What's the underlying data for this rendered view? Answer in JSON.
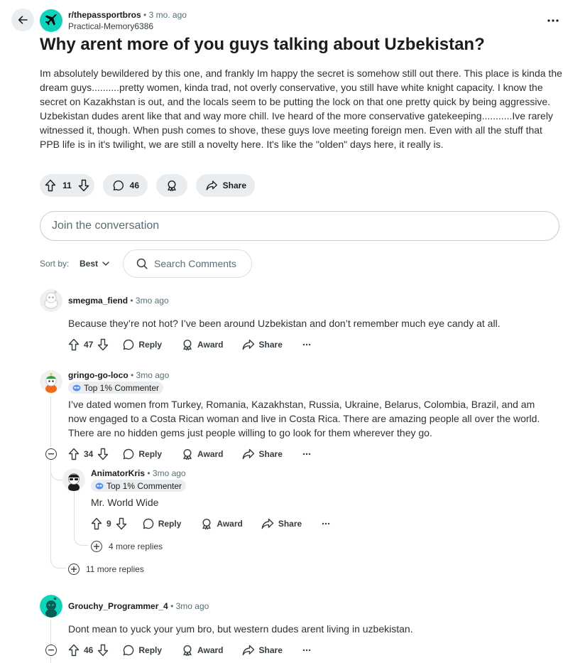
{
  "post": {
    "subreddit": "r/thepassportbros",
    "time_ago": "3 mo. ago",
    "author": "Practical-Memory6386",
    "title": "Why arent more of you guys talking about Uzbekistan?",
    "body": "Im absolutely bewildered by this one, and frankly Im happy the secret is somehow still out there. This place is kinda the dream guys..........pretty women, kinda trad, not overly conservative, you still have white knight capacity. I know the secret on Kazakhstan is out, and the locals seem to be putting the lock on that one pretty quick by being aggressive. Uzbekistan dudes arent like that and way more chill. Ive heard of the more conservative gatekeeping...........Ive rarely witnessed it, though. When push comes to shove, these guys love meeting foreign men. Even with all the stuff that PPB life is in it's twilight, we are still a novelty here. It's like the \"olden\" days here, it really is.",
    "upvotes": "11",
    "comments_count": "46",
    "share_label": "Share"
  },
  "join": {
    "placeholder": "Join the conversation"
  },
  "sort": {
    "label": "Sort by:",
    "value": "Best"
  },
  "search": {
    "placeholder": "Search Comments"
  },
  "labels": {
    "reply": "Reply",
    "award": "Award",
    "share": "Share"
  },
  "comments": [
    {
      "user": "smegma_fiend",
      "time_ago": "3mo ago",
      "body": "Because they’re not hot? I’ve been around Uzbekistan and don’t remember much eye candy at all.",
      "votes": "47"
    },
    {
      "user": "gringo-go-loco",
      "time_ago": "3mo ago",
      "flair": "Top 1% Commenter",
      "body": "I’ve dated women from Turkey, Romania, Kazakhstan, Russia, Ukraine, Belarus, Colombia, Brazil, and am now engaged to a Costa Rican woman and live in Costa Rica. There are amazing people all over the world. There are no hidden gems just people willing to go look for them wherever they go.",
      "votes": "34",
      "more_replies": "11 more replies"
    },
    {
      "user": "AnimatorKris",
      "time_ago": "3mo ago",
      "flair": "Top 1% Commenter",
      "body": "Mr. World Wide",
      "votes": "9",
      "more_replies": "4 more replies"
    },
    {
      "user": "Grouchy_Programmer_4",
      "time_ago": "3mo ago",
      "body": "Dont mean to yuck your yum bro, but western dudes arent living in uzbekistan.",
      "votes": "46"
    }
  ],
  "colors": {
    "subreddit_avatar": "#0dd3bb",
    "pill_bg": "#eaedef",
    "text_primary": "#1c1c1c",
    "text_secondary": "#576f76",
    "thread_line": "#d9dfe2"
  }
}
